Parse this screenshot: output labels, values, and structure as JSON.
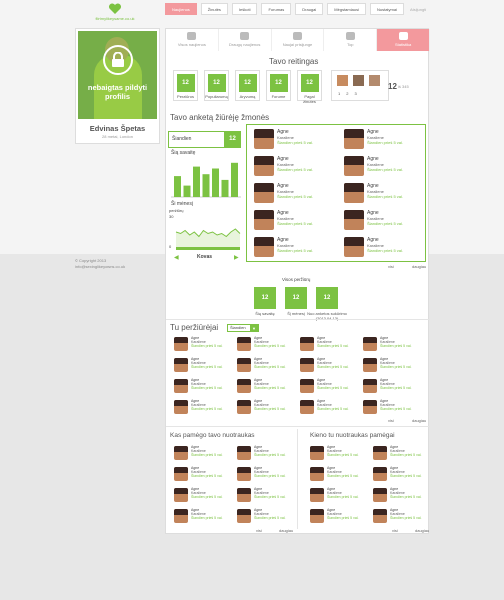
{
  "logo": {
    "text": "flirtmylikeysame.co.uk"
  },
  "nav": [
    "Naujienos",
    "Žinutės",
    "Ieškoti",
    "Forumas",
    "Draugai",
    "Mėgstamiausi",
    "Nustatymai"
  ],
  "logout": "Atsijungti",
  "profile": {
    "warning": "nebaigtas pildyti profilis",
    "name": "Edvinas Špetas",
    "meta": "28 metai, London"
  },
  "footer": {
    "copyright": "© Copyright 2013",
    "email": "info@sexinglikeyowns.co.uk"
  },
  "actions": [
    {
      "label": "Visos naujienos",
      "icon": "news-icon"
    },
    {
      "label": "Draugų naujienos",
      "icon": "friends-icon"
    },
    {
      "label": "Naujai prisijunge",
      "icon": "new-users-icon"
    },
    {
      "label": "Top",
      "icon": "star-icon"
    },
    {
      "label": "Statistika",
      "icon": "stats-icon"
    }
  ],
  "ratings": {
    "title": "Tavo reitingas",
    "items": [
      {
        "value": "12",
        "label": "Perziūros"
      },
      {
        "value": "12",
        "label": "Populiarumą"
      },
      {
        "value": "12",
        "label": "Aryvumą"
      },
      {
        "value": "12",
        "label": "Forume"
      },
      {
        "value": "12",
        "label": "Pagal žinutes"
      }
    ],
    "top_nums": [
      "1",
      "2",
      "3"
    ],
    "total": "12",
    "total_label": "iš 345"
  },
  "viewers": {
    "title": "Tavo anketą žiūrėję žmonės",
    "period": "Šiandien",
    "count": "12",
    "week_label": "Šią savaitę",
    "month_label": "Ši mėnesį",
    "month_chart_label": "peržiūrų",
    "month_name": "Kovas",
    "chart_y_top": "30",
    "chart_y_bottom": "0",
    "week_bars": [
      0.55,
      0.3,
      0.8,
      0.6,
      0.75,
      0.45,
      0.9
    ],
    "month_curve": [
      0.5,
      0.45,
      0.55,
      0.4,
      0.5,
      0.35,
      0.55,
      0.45,
      0.5,
      0.4,
      0.45,
      0.35,
      0.5,
      0.6,
      0.45
    ]
  },
  "person": {
    "name": "Agne",
    "meta": "Karaliene",
    "place": "21, Londonas",
    "seen": "Šiandien prieš 5 val."
  },
  "all_more": "visi",
  "more": "daugiau",
  "total_views": {
    "title": "Visos peržiūrų",
    "items": [
      {
        "value": "12",
        "label": "Šią savaitę"
      },
      {
        "value": "12",
        "label": "Šį mėnesį"
      },
      {
        "value": "12",
        "label": "Nuo anketos sukūrimo (2013.04.13)"
      }
    ]
  },
  "you_viewed": {
    "title": "Tu peržiūrėjai",
    "filter": "Šiandien"
  },
  "who_sees": {
    "title": "Kas pamėgo tavo nuotraukas"
  },
  "whose_you": {
    "title": "Kieno tu nuotraukas pamėgai"
  },
  "colors": {
    "accent": "#7cc242",
    "pink": "#f3999d"
  }
}
